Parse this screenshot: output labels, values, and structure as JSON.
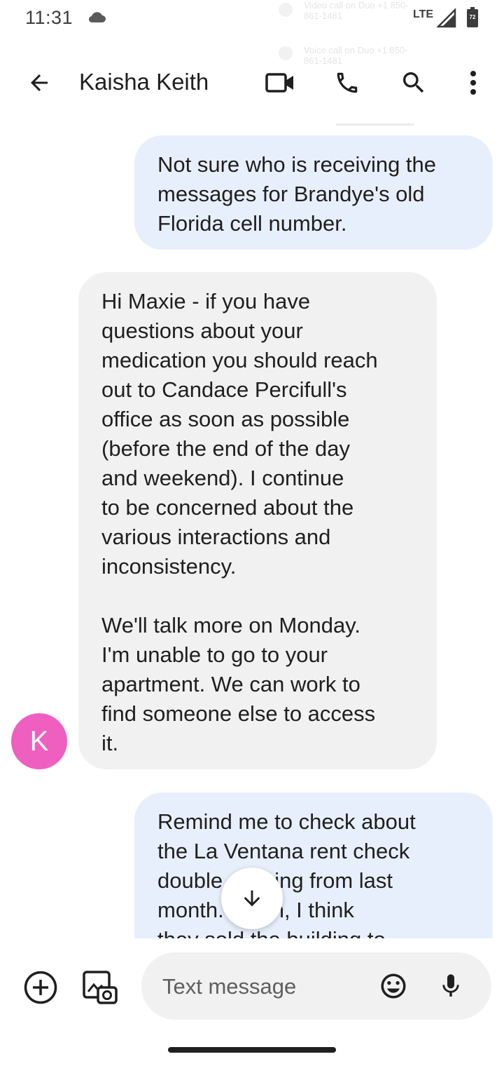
{
  "status_bar": {
    "time": "11:31",
    "network": "LTE",
    "battery_level": "72",
    "icons": [
      "cloud-icon",
      "signal-icon",
      "battery-icon"
    ]
  },
  "overlay_notices": [
    {
      "text": "Video call on Duo +1 850-861-1481"
    },
    {
      "text": "Voice call on Duo +1 850-861-1481"
    }
  ],
  "app_bar": {
    "contact_name": "Kaisha Keith",
    "icons": [
      "back-arrow-icon",
      "video-call-icon",
      "phone-icon",
      "search-icon",
      "more-vert-icon"
    ]
  },
  "conversation": {
    "messages": [
      {
        "direction": "outgoing",
        "text": "Not sure who is receiving the\nmessages for Brandye's old\nFlorida cell number."
      },
      {
        "direction": "incoming",
        "text": "Hi Maxie - if you have\nquestions about your\nmedication you should reach\nout to Candace Percifull's\noffice as soon as possible\n(before the end of the day\nand weekend). I continue\nto be concerned about the\nvarious interactions and\ninconsistency.\n\nWe'll talk more on Monday.\nI'm unable to go to your\napartment. We can work to\nfind someone else to access\nit."
      },
      {
        "direction": "outgoing",
        "text": "Remind me to check about\nthe La Ventana rent check\ndouble cashing from last\nmonth. Again, I think\nthey sold the building to"
      }
    ],
    "avatar_initial": "K",
    "avatar_color": "#ee5fbf"
  },
  "compose": {
    "placeholder": "Text message",
    "icons": [
      "add-icon",
      "gallery-icon",
      "emoji-icon",
      "mic-icon",
      "arrow-down-icon"
    ]
  },
  "colors": {
    "outgoing_bubble": "#e8effc",
    "incoming_bubble": "#f1f1f1",
    "text": "#1f1f1f"
  }
}
